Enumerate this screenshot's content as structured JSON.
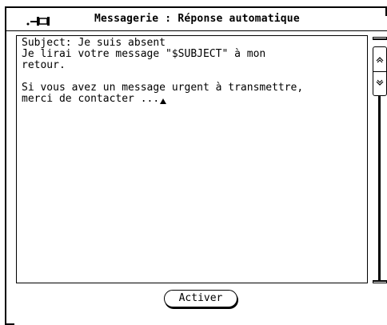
{
  "window": {
    "title": "Messagerie : Réponse automatique",
    "pin_icon": "pushpin-icon"
  },
  "editor": {
    "lines": [
      "Subject: Je suis absent",
      "Je lirai votre message \"$SUBJECT\" à mon",
      "retour.",
      "",
      "Si vous avez un message urgent à transmettre,",
      "merci de contacter ..."
    ]
  },
  "scrollbar": {
    "up_icon": "scroll-up-arrow-icon",
    "down_icon": "scroll-down-arrow-icon"
  },
  "actions": {
    "activate_label": "Activer"
  }
}
